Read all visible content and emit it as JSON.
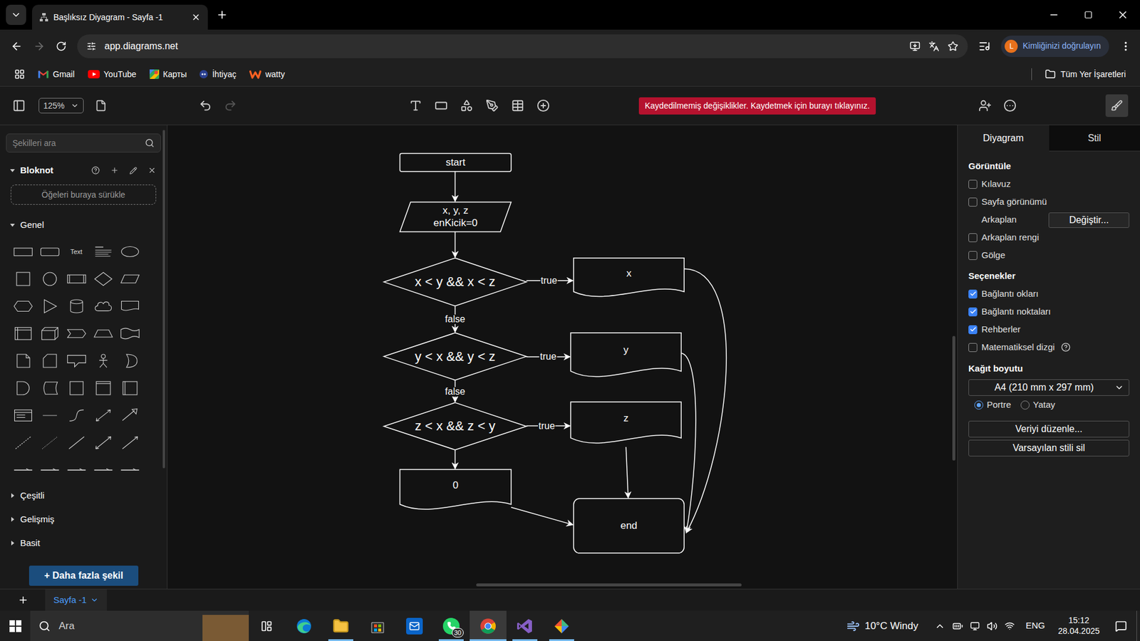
{
  "browser": {
    "tab_title": "Başlıksız Diyagram - Sayfa -1",
    "url": "app.diagrams.net",
    "forward_disabled": true,
    "profile_initial": "L",
    "profile_label": "Kimliğinizi doğrulayın",
    "bookmarks": [
      {
        "label": "Gmail",
        "kind": "gmail"
      },
      {
        "label": "YouTube",
        "kind": "youtube"
      },
      {
        "label": "Карты",
        "kind": "maps"
      },
      {
        "label": "İhtiyaç",
        "kind": "ihtiyac"
      },
      {
        "label": "watty",
        "kind": "watty"
      }
    ],
    "all_bookmarks": "Tüm Yer İşaretleri"
  },
  "toolbar": {
    "zoom": "125%",
    "redo_disabled": true,
    "unsaved_banner": "Kaydedilmemiş değişiklikler. Kaydetmek için burayı tıklayınız.",
    "format_panel_open": true
  },
  "sidebar": {
    "search_placeholder": "Şekilleri ara",
    "scratchpad": {
      "title": "Bloknot",
      "expanded": true,
      "drop_hint": "Öğeleri buraya sürükle"
    },
    "general": {
      "title": "Genel",
      "expanded": true,
      "text_shape_label": "Text"
    },
    "sections": [
      {
        "title": "Çeşitli",
        "expanded": false
      },
      {
        "title": "Gelişmiş",
        "expanded": false
      },
      {
        "title": "Basit",
        "expanded": false
      }
    ],
    "more_shapes": "+ Daha fazla şekil"
  },
  "diagram": {
    "nodes": [
      {
        "kind": "terminal",
        "lines": [
          "start"
        ]
      },
      {
        "kind": "input",
        "lines": [
          "x, y, z",
          "enKicik=0"
        ]
      },
      {
        "kind": "decision",
        "lines": [
          "x < y && x < z"
        ]
      },
      {
        "kind": "document",
        "lines": [
          "x"
        ]
      },
      {
        "kind": "decision",
        "lines": [
          "y < x && y < z"
        ]
      },
      {
        "kind": "document",
        "lines": [
          "y"
        ]
      },
      {
        "kind": "decision",
        "lines": [
          "z < x && z < y"
        ]
      },
      {
        "kind": "document",
        "lines": [
          "z"
        ]
      },
      {
        "kind": "document",
        "lines": [
          "0"
        ]
      },
      {
        "kind": "end",
        "lines": [
          "end"
        ]
      }
    ],
    "edges": [
      {
        "label": ""
      },
      {
        "label": ""
      },
      {
        "label": "true"
      },
      {
        "label": "false"
      },
      {
        "label": "true"
      },
      {
        "label": "false"
      },
      {
        "label": "true"
      },
      {
        "label": ""
      },
      {
        "label": ""
      },
      {
        "label": ""
      },
      {
        "label": ""
      },
      {
        "label": ""
      }
    ]
  },
  "format_panel": {
    "tabs": [
      {
        "label": "Diyagram",
        "selected": true
      },
      {
        "label": "Stil",
        "selected": false
      }
    ],
    "view_title": "Görüntüle",
    "view_items": [
      {
        "kind": "checkbox",
        "label": "Kılavuz",
        "checked": false
      },
      {
        "kind": "checkbox",
        "label": "Sayfa görünümü",
        "checked": false
      },
      {
        "kind": "button",
        "label": "Arkaplan",
        "button": "Değiştir..."
      },
      {
        "kind": "checkbox",
        "label": "Arkaplan rengi",
        "checked": false
      },
      {
        "kind": "checkbox",
        "label": "Gölge",
        "checked": false
      }
    ],
    "options_title": "Seçenekler",
    "options": [
      {
        "label": "Bağlantı okları",
        "checked": true,
        "help": false
      },
      {
        "label": "Bağlantı noktaları",
        "checked": true,
        "help": false
      },
      {
        "label": "Rehberler",
        "checked": true,
        "help": false
      },
      {
        "label": "Matematiksel dizgi",
        "checked": false,
        "help": true
      }
    ],
    "paper_title": "Kağıt boyutu",
    "paper_size": "A4 (210 mm x 297 mm)",
    "orientation": [
      {
        "label": "Portre",
        "selected": true
      },
      {
        "label": "Yatay",
        "selected": false
      }
    ],
    "buttons": [
      "Veriyi düzenle...",
      "Varsayılan stili sil"
    ]
  },
  "page_tabs": [
    {
      "label": "Sayfa -1",
      "selected": true
    }
  ],
  "taskbar": {
    "search": "Ara",
    "apps": [
      {
        "kind": "edge",
        "running": false,
        "active": false,
        "badge": ""
      },
      {
        "kind": "explorer",
        "running": true,
        "active": false,
        "badge": ""
      },
      {
        "kind": "store",
        "running": false,
        "active": false,
        "badge": ""
      },
      {
        "kind": "outlook",
        "running": false,
        "active": false,
        "badge": ""
      },
      {
        "kind": "whatsapp",
        "running": true,
        "active": false,
        "badge": "30"
      },
      {
        "kind": "chrome",
        "running": true,
        "active": true,
        "badge": ""
      },
      {
        "kind": "vs",
        "running": true,
        "active": false,
        "badge": ""
      },
      {
        "kind": "git",
        "running": true,
        "active": false,
        "badge": ""
      }
    ],
    "weather": "10°C Windy",
    "language": "ENG",
    "time": "15:12",
    "date": "28.04.2025"
  }
}
